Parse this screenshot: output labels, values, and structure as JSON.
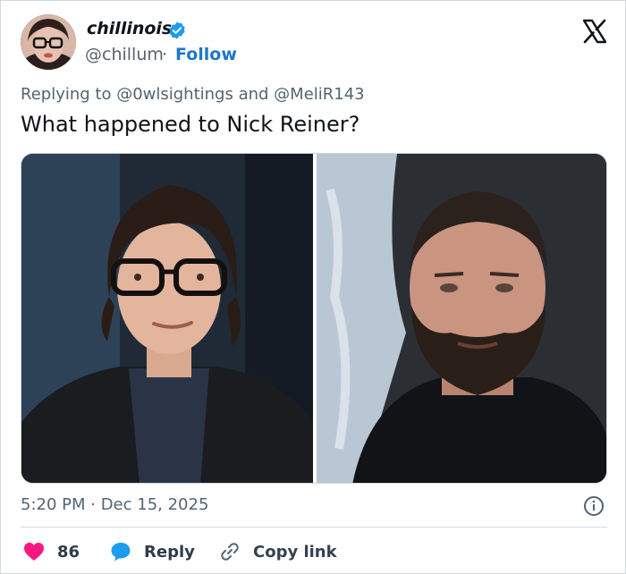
{
  "author": {
    "name": "chillinois",
    "handle": "@chillum",
    "separator": "·",
    "follow_label": "Follow"
  },
  "reply_context": "Replying to @0wlsightings and @MeliR143",
  "tweet_text": "What happened to Nick Reiner?",
  "timestamp": "5:20 PM · Dec 15, 2025",
  "actions": {
    "like_count": "86",
    "reply_label": "Reply",
    "copy_link_label": "Copy link"
  },
  "colors": {
    "like": "#f91880",
    "reply": "#1d9bf0",
    "link_blue": "#1d76c9",
    "verified": "#1d9bf0",
    "secondary_text": "#536471"
  },
  "icons": {
    "verified": "verified-badge-icon",
    "platform": "x-logo-icon",
    "info": "info-icon",
    "like": "heart-icon",
    "reply": "speech-bubble-icon",
    "copy": "link-icon"
  }
}
